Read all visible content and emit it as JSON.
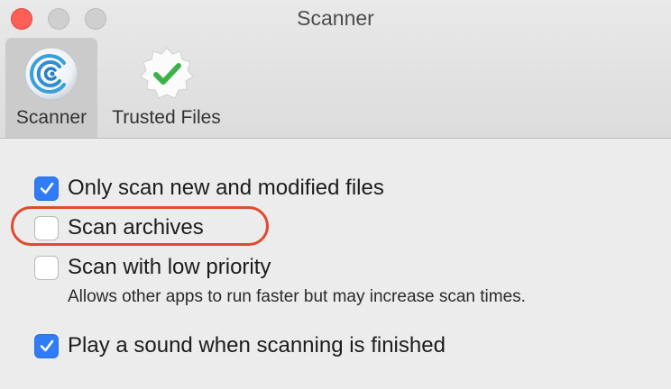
{
  "window": {
    "title": "Scanner"
  },
  "tabs": [
    {
      "label": "Scanner",
      "icon": "radar-scan-icon",
      "selected": true
    },
    {
      "label": "Trusted Files",
      "icon": "verified-badge-icon",
      "selected": false
    }
  ],
  "options": [
    {
      "label": "Only scan new and modified files",
      "checked": true
    },
    {
      "label": "Scan archives",
      "checked": false
    },
    {
      "label": "Scan with low priority",
      "checked": false,
      "description": "Allows other apps to run faster but may increase scan times."
    },
    {
      "label": "Play a sound when scanning is finished",
      "checked": true
    }
  ],
  "colors": {
    "accent": "#2f7cf6",
    "highlight": "#e04a2f",
    "close": "#fd5f57"
  }
}
